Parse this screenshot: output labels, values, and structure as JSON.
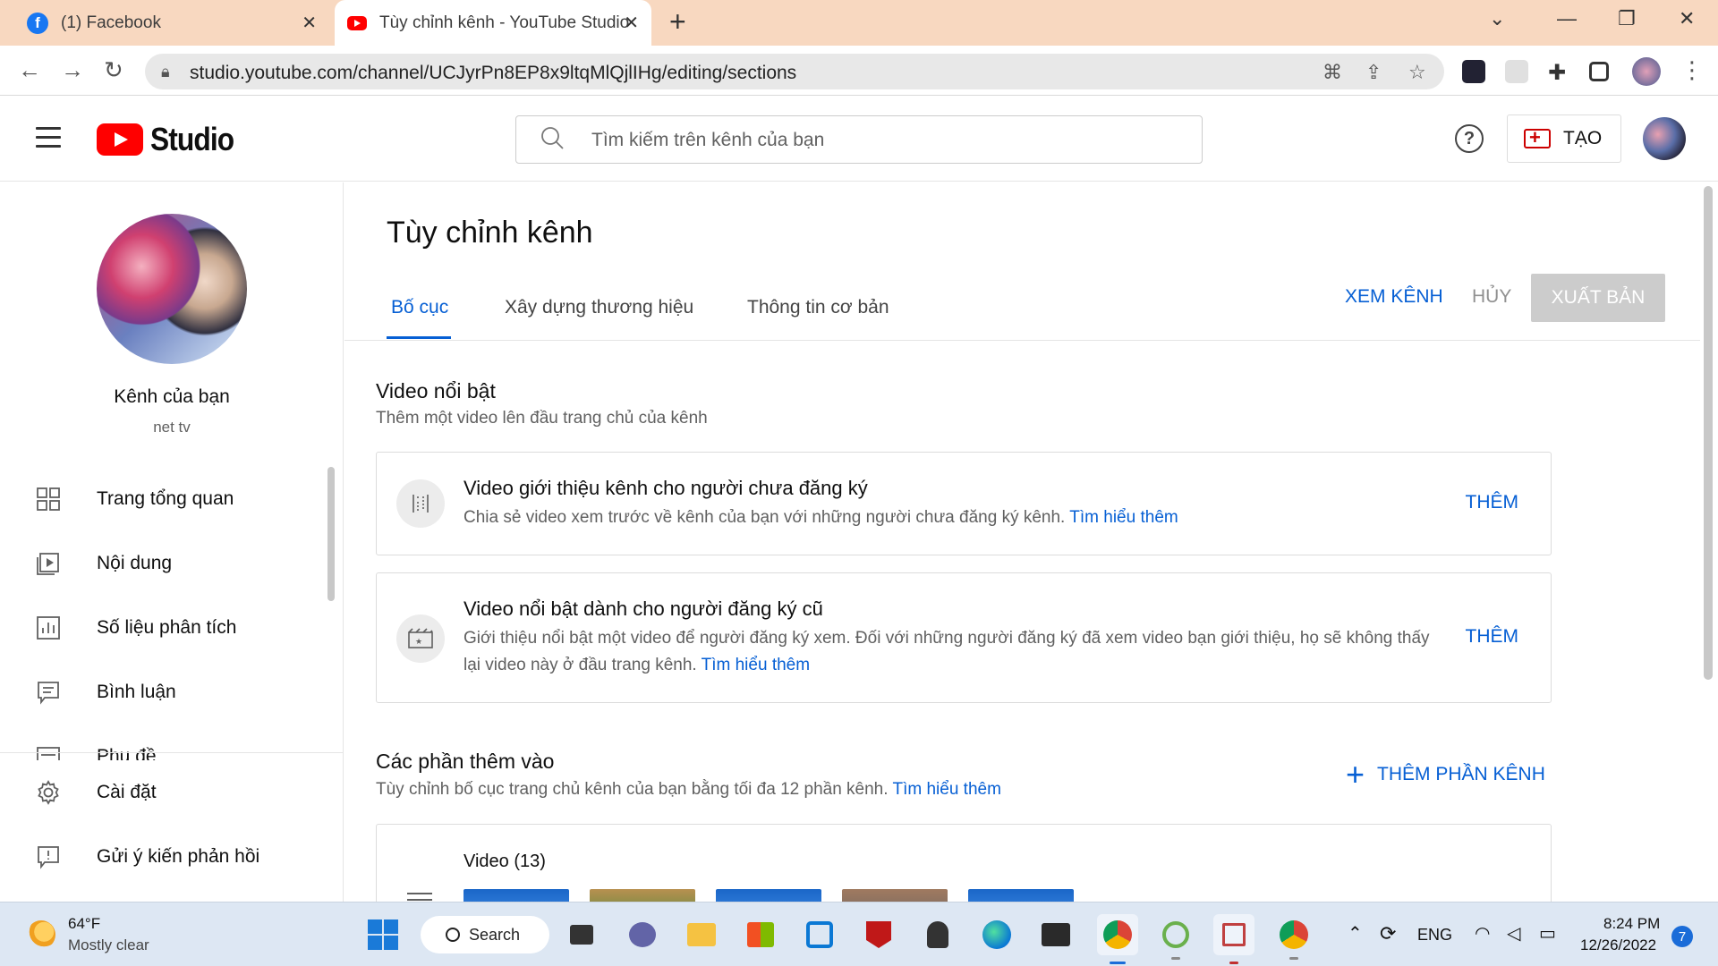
{
  "browser": {
    "tabs": [
      {
        "title": "(1) Facebook"
      },
      {
        "title": "Tùy chỉnh kênh - YouTube Studio"
      }
    ],
    "url": "studio.youtube.com/channel/UCJyrPn8EP8x9ltqMlQjlIHg/editing/sections"
  },
  "header": {
    "logo_text": "Studio",
    "search_placeholder": "Tìm kiếm trên kênh của bạn",
    "create_label": "TẠO"
  },
  "sidebar": {
    "channel_name": "Kênh của bạn",
    "channel_handle": "net tv",
    "items": [
      {
        "label": "Trang tổng quan",
        "icon": "dashboard-icon"
      },
      {
        "label": "Nội dung",
        "icon": "content-icon"
      },
      {
        "label": "Số liệu phân tích",
        "icon": "analytics-icon"
      },
      {
        "label": "Bình luận",
        "icon": "comments-icon"
      },
      {
        "label": "Phụ đề",
        "icon": "subtitles-icon"
      }
    ],
    "bottom_items": [
      {
        "label": "Cài đặt",
        "icon": "gear-icon"
      },
      {
        "label": "Gửi ý kiến phản hồi",
        "icon": "feedback-icon"
      }
    ]
  },
  "main": {
    "title": "Tùy chỉnh kênh",
    "tabs": [
      {
        "label": "Bố cục"
      },
      {
        "label": "Xây dựng thương hiệu"
      },
      {
        "label": "Thông tin cơ bản"
      }
    ],
    "actions": {
      "view_channel": "XEM KÊNH",
      "cancel": "HỦY",
      "publish": "XUẤT BẢN"
    },
    "featured": {
      "title": "Video nổi bật",
      "subtitle": "Thêm một video lên đầu trang chủ của kênh",
      "cards": [
        {
          "title": "Video giới thiệu kênh cho người chưa đăng ký",
          "desc": "Chia sẻ video xem trước về kênh của bạn với những người chưa đăng ký kênh.",
          "link": "Tìm hiểu thêm",
          "add": "THÊM"
        },
        {
          "title": "Video nổi bật dành cho người đăng ký cũ",
          "desc_line1": "Giới thiệu nổi bật một video để người đăng ký xem. Đối với những người đăng ký đã xem video bạn giới thiệu, họ sẽ không thấy",
          "desc_line2": "lại video này ở đầu trang kênh.",
          "link": "Tìm hiểu thêm",
          "add": "THÊM"
        }
      ]
    },
    "sections": {
      "title": "Các phần thêm vào",
      "subtitle": "Tùy chỉnh bố cục trang chủ kênh của bạn bằng tối đa 12 phần kênh.",
      "link": "Tìm hiểu thêm",
      "add_section": "THÊM PHẦN KÊNH",
      "video_card_title": "Video (13)"
    }
  },
  "taskbar": {
    "weather_temp": "64°F",
    "weather_cond": "Mostly clear",
    "search_label": "Search",
    "language": "ENG",
    "time": "8:24 PM",
    "date": "12/26/2022",
    "notifications": "7"
  },
  "colors": {
    "accent": "#065fd4",
    "youtube_red": "#ff0000",
    "tabbar": "#f8d8c0",
    "publish_disabled": "#cccccc"
  }
}
